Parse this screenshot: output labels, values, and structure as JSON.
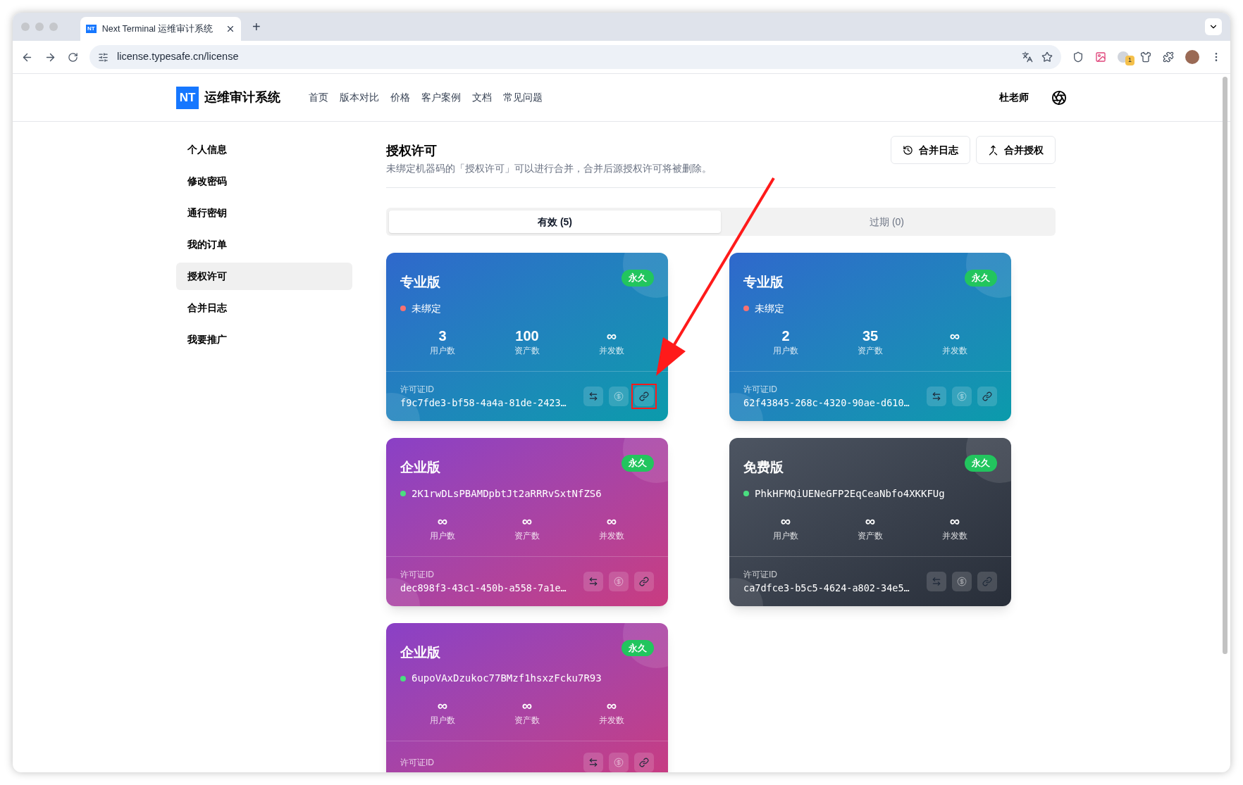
{
  "browser": {
    "tab_favicon": "NT",
    "tab_title": "Next Terminal 运维审计系统",
    "new_tab": "+",
    "url": "license.typesafe.cn/license",
    "extension_badge": "1"
  },
  "header": {
    "logo_mark": "NT",
    "logo_text": "运维审计系统",
    "nav": [
      "首页",
      "版本对比",
      "价格",
      "客户案例",
      "文档",
      "常见问题"
    ],
    "user": "杜老师"
  },
  "sidebar": {
    "items": [
      {
        "label": "个人信息",
        "selected": false
      },
      {
        "label": "修改密码",
        "selected": false
      },
      {
        "label": "通行密钥",
        "selected": false
      },
      {
        "label": "我的订单",
        "selected": false
      },
      {
        "label": "授权许可",
        "selected": true
      },
      {
        "label": "合并日志",
        "selected": false
      },
      {
        "label": "我要推广",
        "selected": false
      }
    ]
  },
  "page": {
    "title": "授权许可",
    "subtitle": "未绑定机器码的「授权许可」可以进行合并，合并后源授权许可将被删除。",
    "buttons": [
      {
        "kind": "history",
        "label": "合并日志"
      },
      {
        "kind": "merge",
        "label": "合并授权"
      }
    ]
  },
  "tabs": [
    {
      "label": "有效 (5)",
      "selected": true
    },
    {
      "label": "过期 (0)",
      "selected": false
    }
  ],
  "cards": [
    {
      "kind": "pro",
      "edition": "专业版",
      "badge": "永久",
      "status": "未绑定",
      "color": "#f87171",
      "stats": [
        {
          "value": "3",
          "label": "用户数"
        },
        {
          "value": "100",
          "label": "资产数"
        },
        {
          "value": "∞",
          "label": "并发数"
        }
      ],
      "id_label": "许可证ID",
      "id": "f9c7fde3-bf58-4a4a-81de-2423…",
      "highlighted": true
    },
    {
      "kind": "pro",
      "edition": "专业版",
      "badge": "永久",
      "status": "未绑定",
      "color": "#f87171",
      "stats": [
        {
          "value": "2",
          "label": "用户数"
        },
        {
          "value": "35",
          "label": "资产数"
        },
        {
          "value": "∞",
          "label": "并发数"
        }
      ],
      "id_label": "许可证ID",
      "id": "62f43845-268c-4320-90ae-d610…",
      "highlighted": false
    },
    {
      "kind": "enterprise",
      "edition": "企业版",
      "badge": "永久",
      "status": "2K1rwDLsPBAMDpbtJt2aRRRvSxtNfZS6",
      "color": "#4ade80",
      "stats": [
        {
          "value": "∞",
          "label": "用户数"
        },
        {
          "value": "∞",
          "label": "资产数"
        },
        {
          "value": "∞",
          "label": "并发数"
        }
      ],
      "id_label": "许可证ID",
      "id": "dec898f3-43c1-450b-a558-7a1e…",
      "highlighted": false
    },
    {
      "kind": "free",
      "edition": "免费版",
      "badge": "永久",
      "status": "PhkHFMQiUENeGFP2EqCeaNbfo4XKKFUg",
      "color": "#4ade80",
      "stats": [
        {
          "value": "∞",
          "label": "用户数"
        },
        {
          "value": "∞",
          "label": "资产数"
        },
        {
          "value": "∞",
          "label": "并发数"
        }
      ],
      "id_label": "许可证ID",
      "id": "ca7dfce3-b5c5-4624-a802-34e5…",
      "highlighted": false
    },
    {
      "kind": "enterprise",
      "edition": "企业版",
      "badge": "永久",
      "status": "6upoVAxDzukoc77BMzf1hsxzFcku7R93",
      "color": "#4ade80",
      "stats": [
        {
          "value": "∞",
          "label": "用户数"
        },
        {
          "value": "∞",
          "label": "资产数"
        },
        {
          "value": "∞",
          "label": "并发数"
        }
      ],
      "id_label": "许可证ID",
      "highlighted": false
    }
  ]
}
